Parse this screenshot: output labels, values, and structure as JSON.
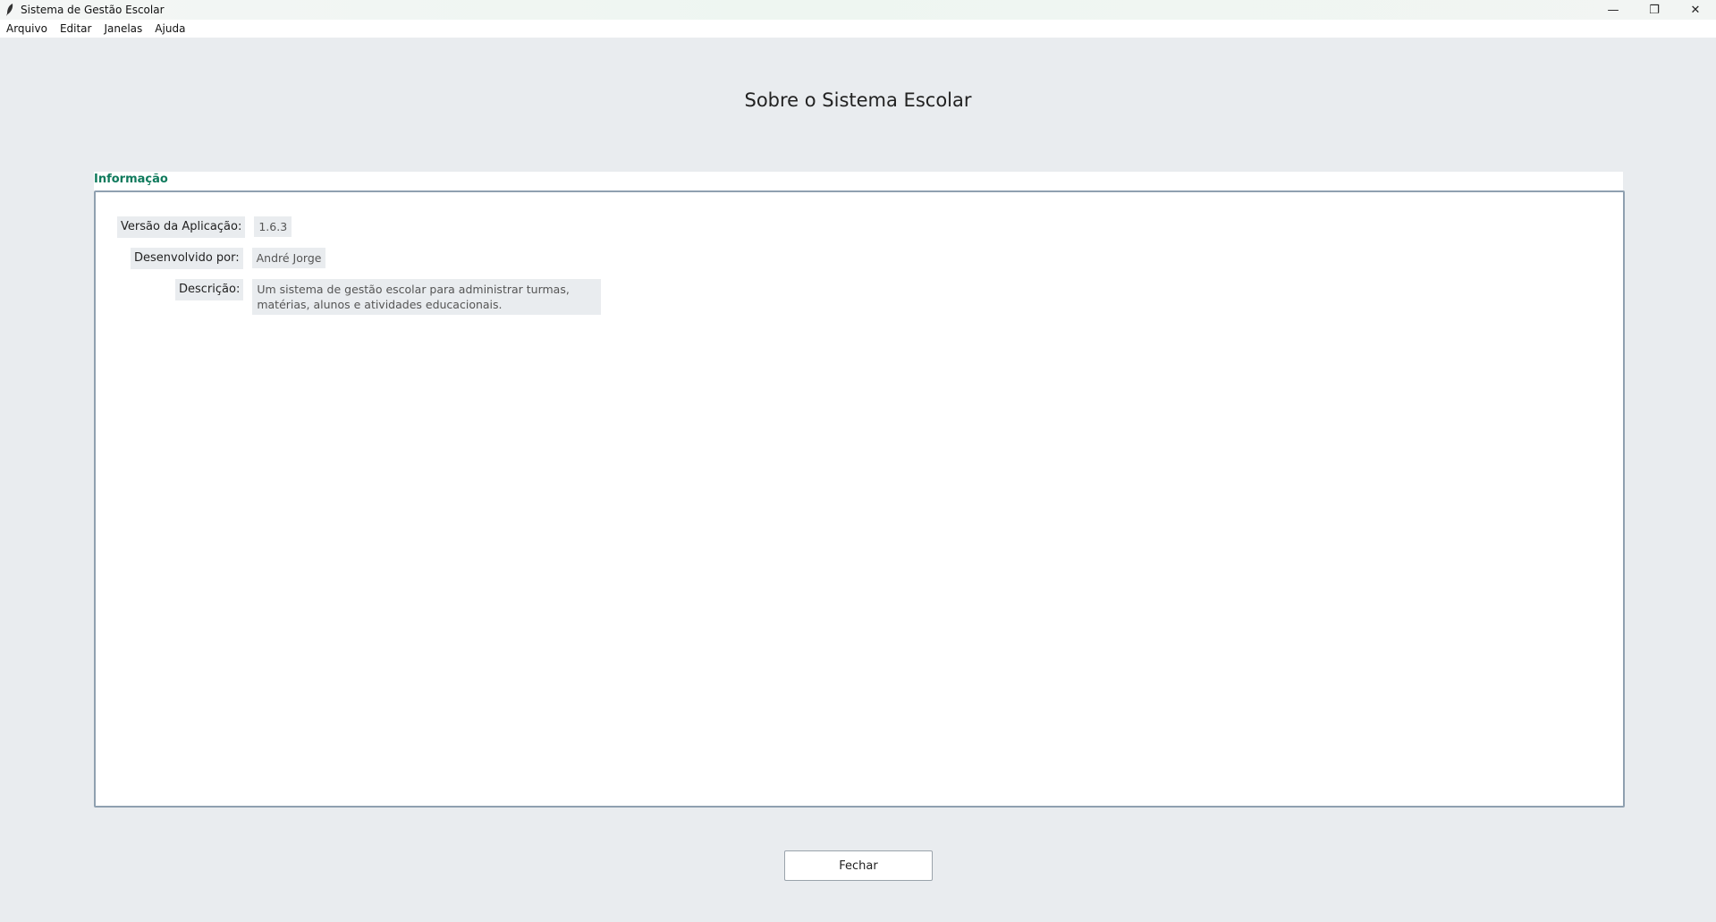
{
  "window": {
    "title": "Sistema de Gestão Escolar",
    "controls": {
      "minimize": "—",
      "maximize": "❐",
      "close": "✕"
    }
  },
  "menubar": {
    "items": [
      {
        "label": "Arquivo"
      },
      {
        "label": "Editar"
      },
      {
        "label": "Janelas"
      },
      {
        "label": "Ajuda"
      }
    ]
  },
  "main": {
    "title": "Sobre o Sistema Escolar",
    "info_group": {
      "label": "Informação",
      "fields": [
        {
          "label": "Versão da Aplicação:",
          "value": "1.6.3"
        },
        {
          "label": "Desenvolvido por:",
          "value": "André Jorge"
        },
        {
          "label": "Descrição:",
          "value": "Um sistema de gestão escolar para administrar turmas, matérias, alunos e atividades educacionais."
        }
      ]
    },
    "close_button_label": "Fechar"
  },
  "colors": {
    "group_label": "#0f7a5c",
    "background": "#e9ecef",
    "panel": "#ffffff"
  },
  "icons": {
    "app": "feather-icon"
  }
}
